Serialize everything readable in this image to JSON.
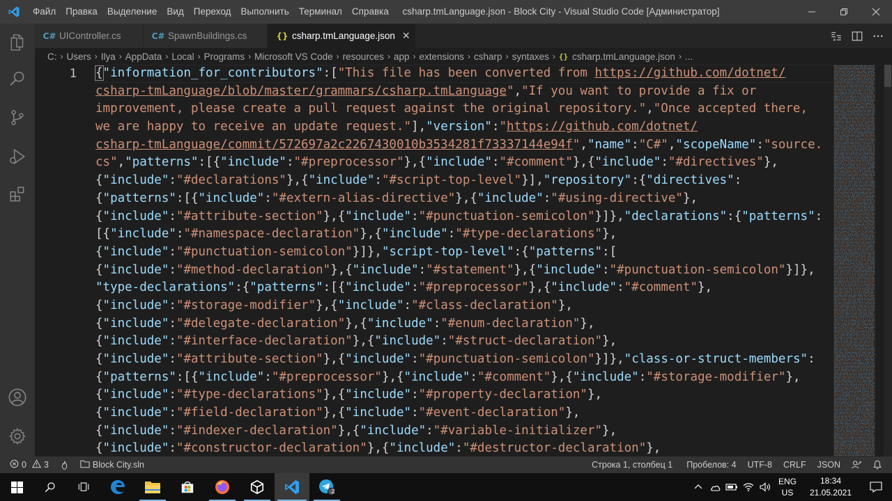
{
  "titlebar": {
    "menu": [
      "Файл",
      "Правка",
      "Выделение",
      "Вид",
      "Переход",
      "Выполнить",
      "Терминал",
      "Справка"
    ],
    "title": "csharp.tmLanguage.json - Block City - Visual Studio Code [Администратор]"
  },
  "tabs": [
    {
      "label": "UIController.cs",
      "icon": "C#",
      "active": false
    },
    {
      "label": "SpawnBuildings.cs",
      "icon": "C#",
      "active": false
    },
    {
      "label": "csharp.tmLanguage.json",
      "icon": "{}",
      "active": true
    }
  ],
  "breadcrumb": [
    "C:",
    "Users",
    "Ilya",
    "AppData",
    "Local",
    "Programs",
    "Microsoft VS Code",
    "resources",
    "app",
    "extensions",
    "csharp",
    "syntaxes"
  ],
  "breadcrumb_file": "csharp.tmLanguage.json",
  "breadcrumb_more": "...",
  "editor": {
    "line_number": "1",
    "lines": [
      "{\"information_for_contributors\":[\"This file has been converted from https://github.com/dotnet/",
      "csharp-tmLanguage/blob/master/grammars/csharp.tmLanguage\",\"If you want to provide a fix or",
      "improvement, please create a pull request against the original repository.\",\"Once accepted there,",
      "we are happy to receive an update request.\"],\"version\":\"https://github.com/dotnet/",
      "csharp-tmLanguage/commit/572697a2c2267430010b3534281f73337144e94f\",\"name\":\"C#\",\"scopeName\":\"source.",
      "cs\",\"patterns\":[{\"include\":\"#preprocessor\"},{\"include\":\"#comment\"},{\"include\":\"#directives\"},",
      "{\"include\":\"#declarations\"},{\"include\":\"#script-top-level\"}],\"repository\":{\"directives\":",
      "{\"patterns\":[{\"include\":\"#extern-alias-directive\"},{\"include\":\"#using-directive\"},",
      "{\"include\":\"#attribute-section\"},{\"include\":\"#punctuation-semicolon\"}]},\"declarations\":{\"patterns\":",
      "[{\"include\":\"#namespace-declaration\"},{\"include\":\"#type-declarations\"},",
      "{\"include\":\"#punctuation-semicolon\"}]},\"script-top-level\":{\"patterns\":[",
      "{\"include\":\"#method-declaration\"},{\"include\":\"#statement\"},{\"include\":\"#punctuation-semicolon\"}]},",
      "\"type-declarations\":{\"patterns\":[{\"include\":\"#preprocessor\"},{\"include\":\"#comment\"},",
      "{\"include\":\"#storage-modifier\"},{\"include\":\"#class-declaration\"},",
      "{\"include\":\"#delegate-declaration\"},{\"include\":\"#enum-declaration\"},",
      "{\"include\":\"#interface-declaration\"},{\"include\":\"#struct-declaration\"},",
      "{\"include\":\"#attribute-section\"},{\"include\":\"#punctuation-semicolon\"}]},\"class-or-struct-members\":",
      "{\"patterns\":[{\"include\":\"#preprocessor\"},{\"include\":\"#comment\"},{\"include\":\"#storage-modifier\"},",
      "{\"include\":\"#type-declarations\"},{\"include\":\"#property-declaration\"},",
      "{\"include\":\"#field-declaration\"},{\"include\":\"#event-declaration\"},",
      "{\"include\":\"#indexer-declaration\"},{\"include\":\"#variable-initializer\"},",
      "{\"include\":\"#constructor-declaration\"},{\"include\":\"#destructor-declaration\"},"
    ]
  },
  "statusbar": {
    "errors": "0",
    "warnings": "3",
    "solution": "Block City.sln",
    "position": "Строка 1, столбец 1",
    "spaces": "Пробелов: 4",
    "encoding": "UTF-8",
    "eol": "CRLF",
    "language": "JSON"
  },
  "taskbar": {
    "lang_top": "ENG",
    "lang_bottom": "US",
    "time": "18:34",
    "date": "21.05.2021",
    "telegram_badge": "2"
  },
  "colors": {
    "accent": "#007acc",
    "string": "#ce9178",
    "key": "#9cdcfe",
    "json_icon": "#cbcb41",
    "csharp_icon": "#519aba"
  }
}
